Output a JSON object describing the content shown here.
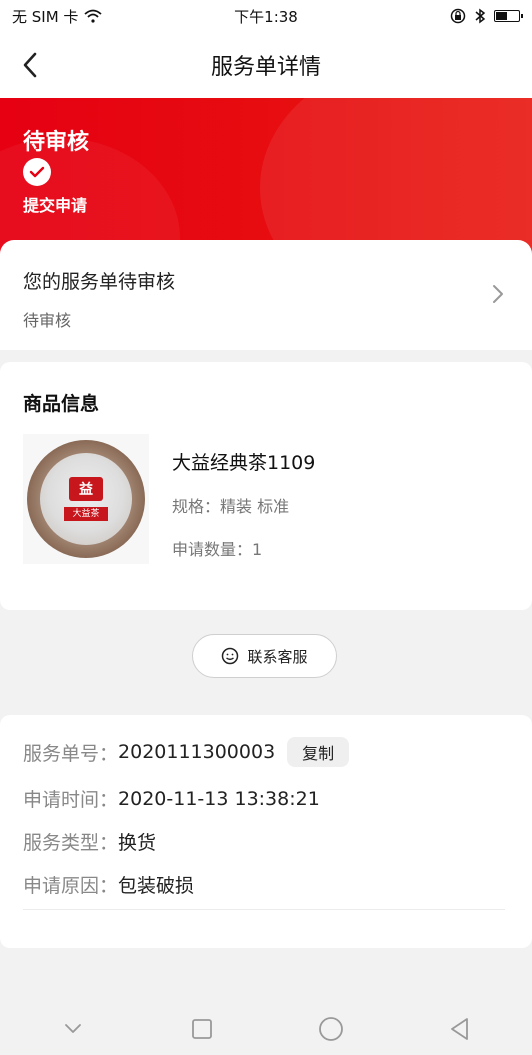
{
  "status_bar": {
    "carrier": "无 SIM 卡",
    "time": "下午1:38"
  },
  "nav": {
    "title": "服务单详情"
  },
  "hero": {
    "status": "待审核",
    "step": "提交申请",
    "bg_color": "#e60012"
  },
  "status_card": {
    "title": "您的服务单待审核",
    "subtitle": "待审核"
  },
  "goods": {
    "heading": "商品信息",
    "name": "大益经典茶1109",
    "spec": "规格：精装 标准",
    "qty": "申请数量：1",
    "thumb_logo": "益",
    "thumb_label": "大益茶"
  },
  "contact_button": {
    "label": "联系客服"
  },
  "info": {
    "order_no_label": "服务单号：",
    "order_no": "2020111300003",
    "copy_label": "复制",
    "time_label": "申请时间：",
    "time": "2020-11-13 13:38:21",
    "type_label": "服务类型：",
    "type": "换货",
    "reason_label": "申请原因：",
    "reason": "包装破损"
  },
  "icons": {
    "back": "chevron-left-icon",
    "chevron": "chevron-right-icon",
    "check": "check-icon",
    "service": "smiley-chat-icon",
    "wifi": "wifi-icon",
    "lock": "lock-rotation-icon",
    "bluetooth": "bluetooth-icon",
    "battery": "battery-icon"
  }
}
